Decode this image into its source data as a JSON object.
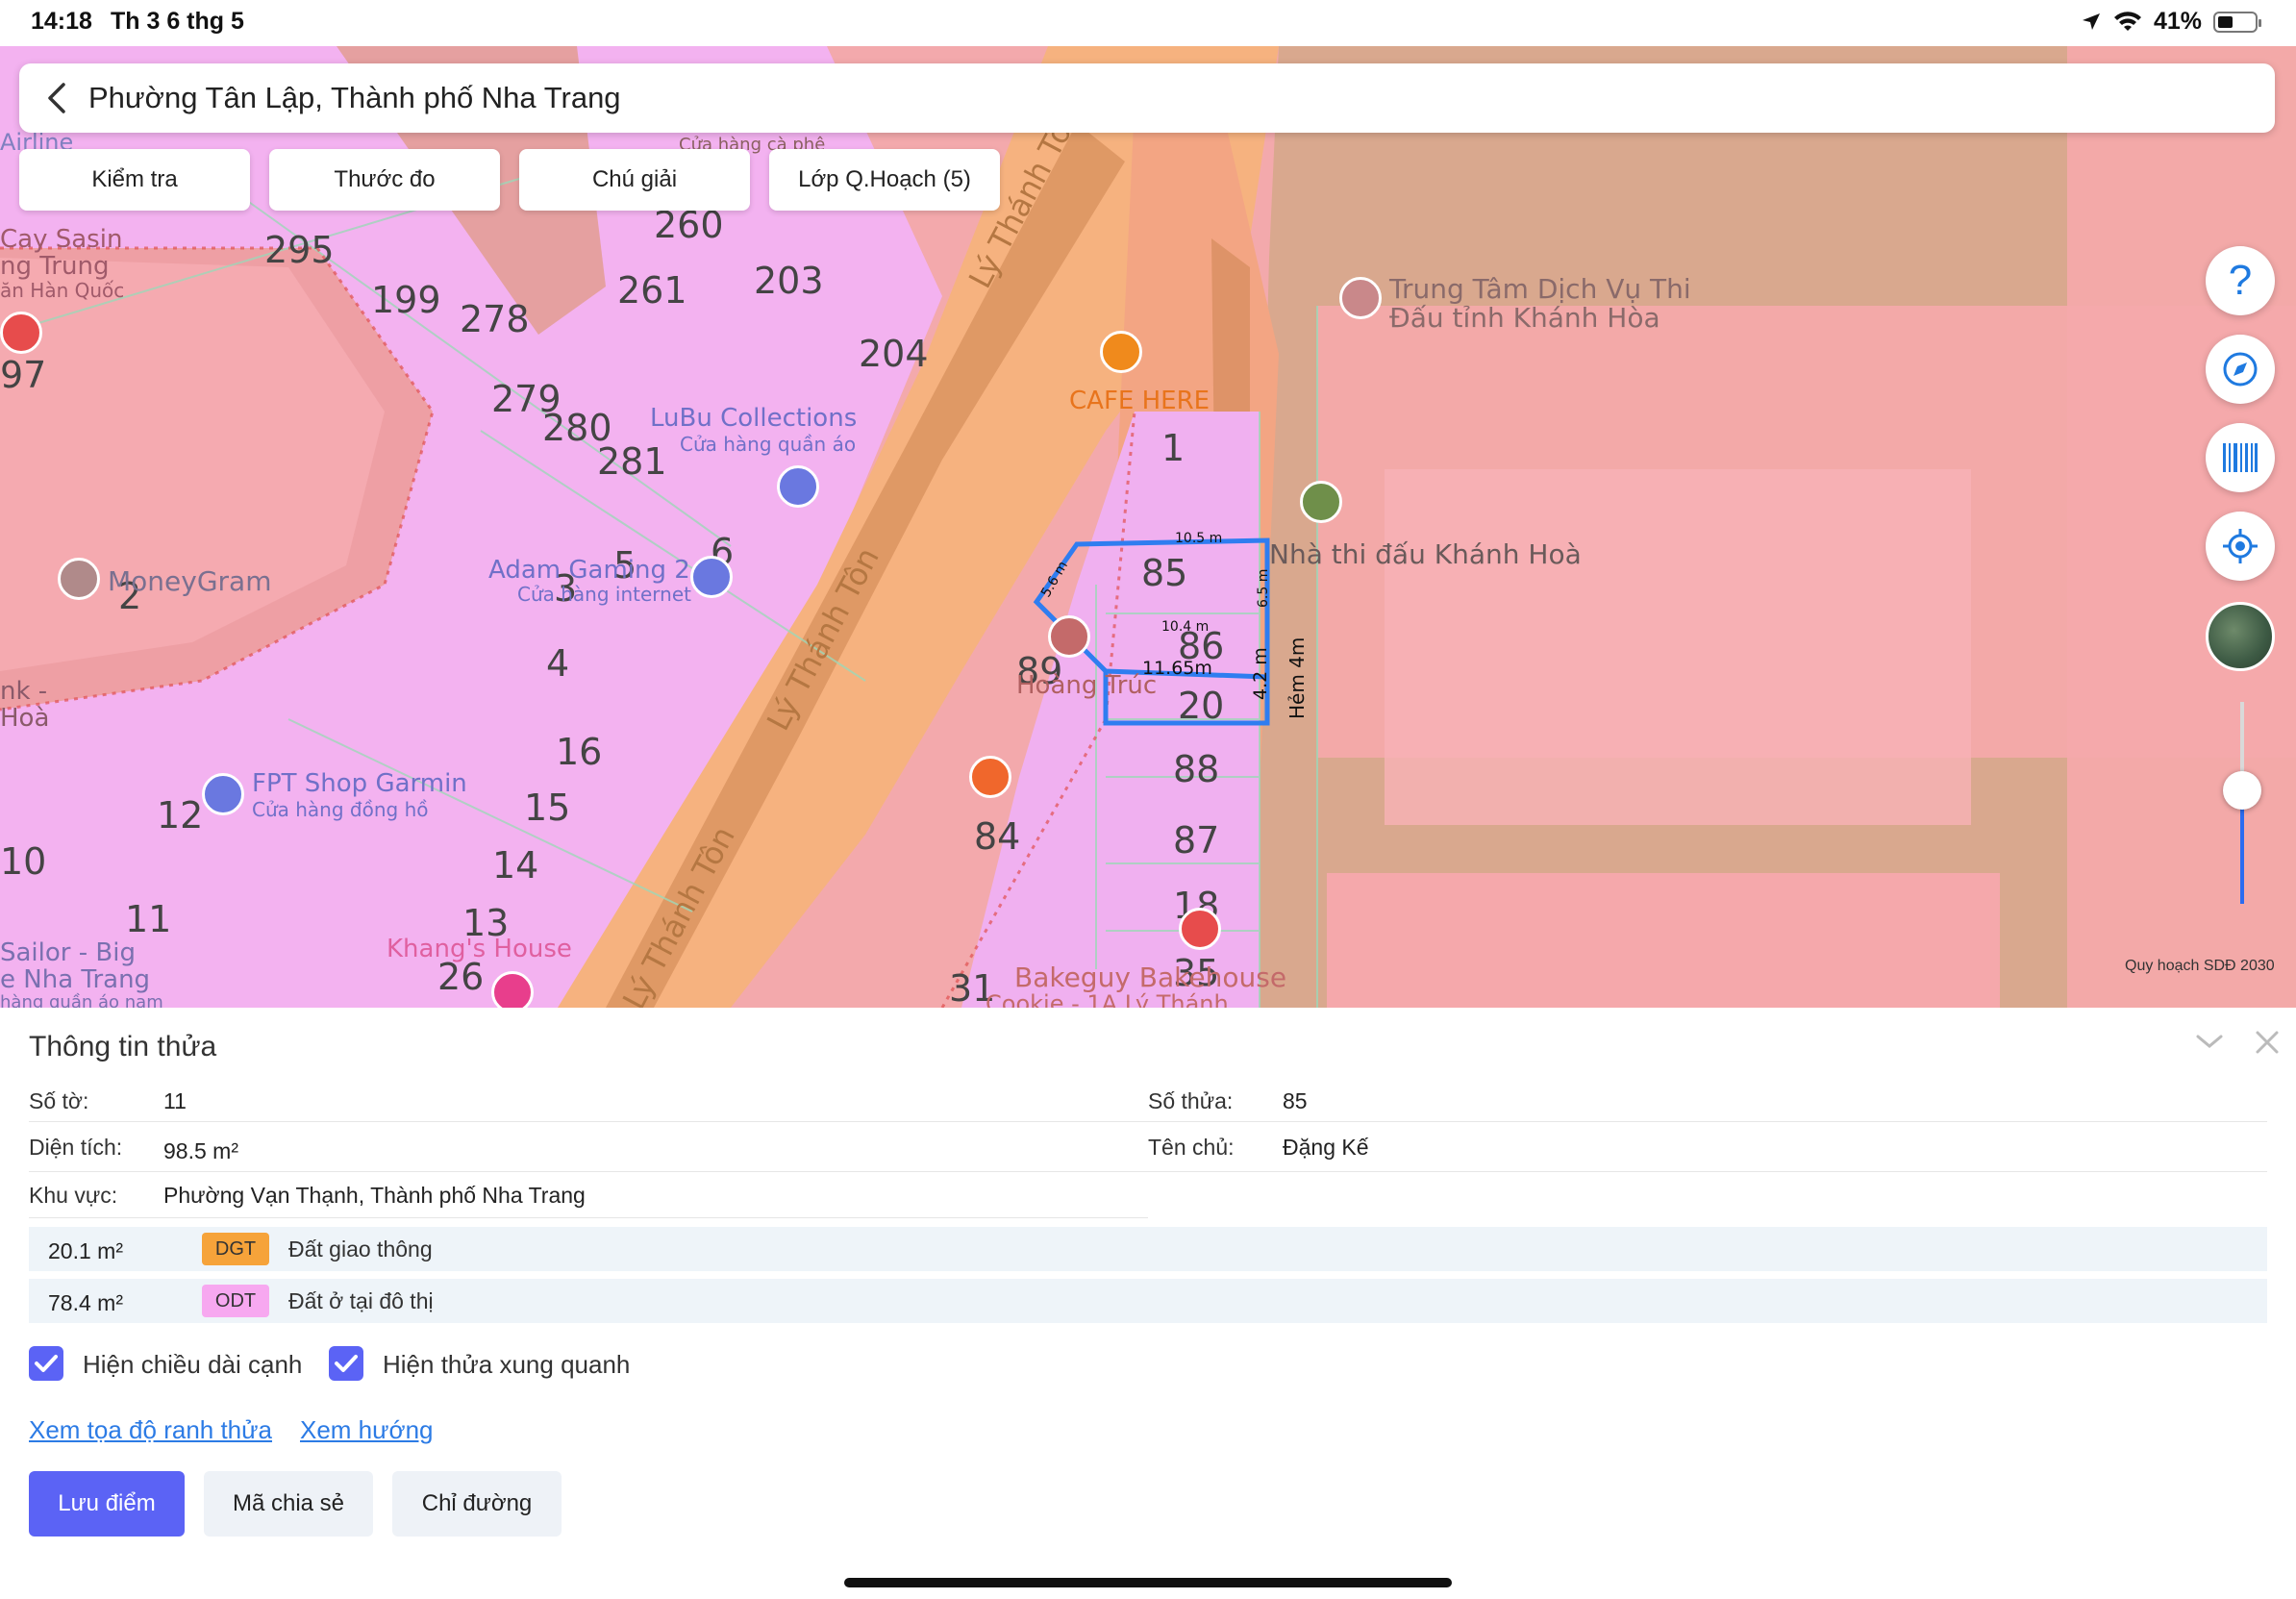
{
  "status_bar": {
    "time": "14:18",
    "date": "Th 3 6 thg 5",
    "battery": "41%",
    "battery_level": 0.41
  },
  "header": {
    "title": "Phường Tân Lập, Thành phố Nha Trang",
    "back_icon": "chevron-left-icon"
  },
  "map_buttons": [
    "Kiểm tra",
    "Thước đo",
    "Chú giải",
    "Lớp Q.Hoạch (5)"
  ],
  "side_controls": {
    "icons": [
      "help-icon",
      "compass-icon",
      "barcode-icon",
      "locate-icon",
      "satellite-layer-icon"
    ],
    "help_glyph": "?",
    "zoom_level": 0.57
  },
  "map": {
    "caption": "Quy hoạch SDĐ 2030",
    "parcel_numbers": [
      "295",
      "199",
      "278",
      "279",
      "280",
      "281",
      "261",
      "203",
      "204",
      "260",
      "5",
      "6",
      "3",
      "4",
      "2",
      "16",
      "15",
      "14",
      "13",
      "12",
      "11",
      "26",
      "10",
      "97",
      "84",
      "31",
      "1",
      "85",
      "86",
      "20",
      "88",
      "87",
      "18",
      "35",
      "89"
    ],
    "street_labels": [
      "Lý Thánh Tôn",
      "Lý Thánh Tôn",
      "Lý Thánh Tôn",
      "Hẻm 4m"
    ],
    "pois": [
      {
        "name": "CAFE HERE",
        "sub": ""
      },
      {
        "name": "Trung Tâm Dịch Vụ Thi",
        "sub": "Đấu tỉnh Khánh Hòa"
      },
      {
        "name": "Nhà thi đấu Khánh Hoà",
        "sub": ""
      },
      {
        "name": "LuBu Collections",
        "sub": "Cửa hàng quần áo"
      },
      {
        "name": "Adam Gaming 2",
        "sub": "Cửa hàng internet"
      },
      {
        "name": "MoneyGram",
        "sub": ""
      },
      {
        "name": "FPT Shop Garmin",
        "sub": "Cửa hàng đồng hồ"
      },
      {
        "name": "Khang's House",
        "sub": ""
      },
      {
        "name": "Bakeguy Bakehouse",
        "sub": "Cookie - 1A Lý Thánh"
      },
      {
        "name": "Hoàng Trúc",
        "sub": ""
      },
      {
        "name": "Cay Sasin",
        "sub": "ng Trung"
      },
      {
        "name": "Sailor - Big",
        "sub": "e Nha Trang"
      }
    ],
    "fragments": [
      "Airline",
      "ăn Hàn Quốc",
      "Cửa hàng cà phê",
      "nk -",
      "Hoà",
      "hàng quần áo nam"
    ],
    "measurements": [
      "10.5 m",
      "5.6 m",
      "6.5 m",
      "10.4 m",
      "11.65m",
      "4.2 m"
    ]
  },
  "panel": {
    "title": "Thông tin thửa",
    "so_to_label": "Số tờ:",
    "so_to_value": "11",
    "so_thua_label": "Số thửa:",
    "so_thua_value": "85",
    "dien_tich_label": "Diện tích:",
    "dien_tich_value": "98.5 m²",
    "ten_chu_label": "Tên chủ:",
    "ten_chu_value": "Đặng Kế",
    "khu_vuc_label": "Khu vực:",
    "khu_vuc_value": "Phường Vạn Thạnh, Thành phố Nha Trang",
    "land_uses": [
      {
        "area": "20.1 m²",
        "code": "DGT",
        "name": "Đất giao thông",
        "color": "#f6a33a"
      },
      {
        "area": "78.4 m²",
        "code": "ODT",
        "name": "Đất ở tại đô thị",
        "color": "#f7a8f0"
      }
    ],
    "checkboxes": [
      {
        "label": "Hiện chiều dài cạnh",
        "checked": true
      },
      {
        "label": "Hiện thửa xung quanh",
        "checked": true
      }
    ],
    "links": [
      "Xem tọa độ ranh thửa",
      "Xem hướng"
    ],
    "actions": [
      "Lưu điểm",
      "Mã chia sẻ",
      "Chỉ đường"
    ],
    "accent": "#5b63f5"
  }
}
